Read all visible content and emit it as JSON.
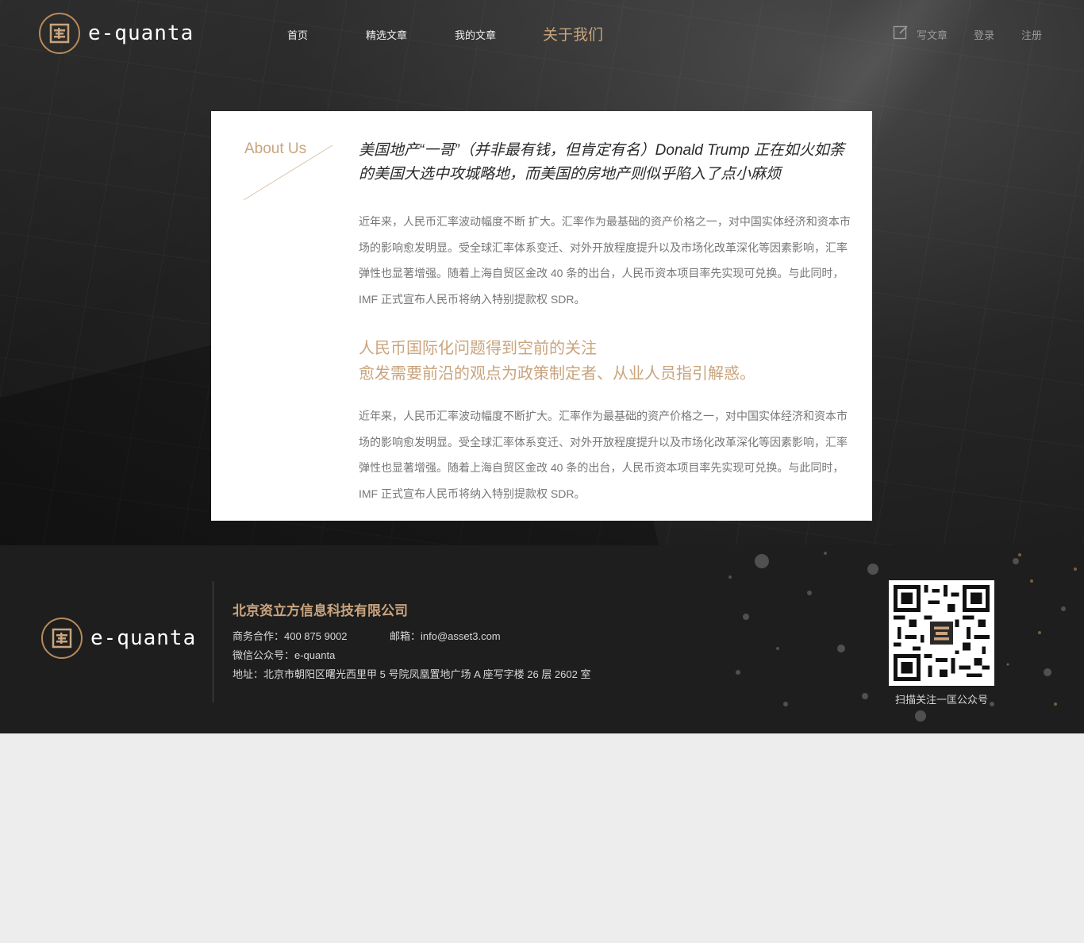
{
  "brand": {
    "name": "e-quanta"
  },
  "nav": {
    "items": [
      {
        "label": "首页"
      },
      {
        "label": "精选文章"
      },
      {
        "label": "我的文章"
      },
      {
        "label": "关于我们"
      }
    ],
    "write_label": "写文章",
    "login_label": "登录",
    "register_label": "注册"
  },
  "about": {
    "label": "About Us",
    "headline": "美国地产“一哥”（并非最有钱，但肯定有名）Donald Trump 正在如火如荼的美国大选中攻城略地，而美国的房地产则似乎陷入了点小麻烦",
    "paragraph1": "近年来，人民币汇率波动幅度不断 扩大。汇率作为最基础的资产价格之一，对中国实体经济和资本市场的影响愈发明显。受全球汇率体系变迁、对外开放程度提升以及市场化改革深化等因素影响，汇率弹性也显著增强。随着上海自贸区金改 40 条的出台，人民币资本项目率先实现可兑换。与此同时，IMF 正式宣布人民币将纳入特别提款权 SDR。",
    "subhead_line1": "人民币国际化问题得到空前的关注",
    "subhead_line2": "愈发需要前沿的观点为政策制定者、从业人员指引解惑。",
    "paragraph2": "近年来，人民币汇率波动幅度不断扩大。汇率作为最基础的资产价格之一，对中国实体经济和资本市场的影响愈发明显。受全球汇率体系变迁、对外开放程度提升以及市场化改革深化等因素影响，汇率弹性也显著增强。随着上海自贸区金改 40 条的出台，人民币资本项目率先实现可兑换。与此同时，IMF 正式宣布人民币将纳入特别提款权 SDR。"
  },
  "footer": {
    "company": "北京资立方信息科技有限公司",
    "business": "商务合作：400 875 9002",
    "email": "邮箱：info@asset3.com",
    "wechat": "微信公众号：e-quanta",
    "address": "地址：北京市朝阳区曙光西里甲 5 号院凤凰置地广场 A 座写字楼 26 层 2602 室",
    "qr_caption": "扫描关注一匡公众号"
  },
  "colors": {
    "accent": "#c9a47d",
    "footer_bg": "#1e1e1e",
    "page_bg": "#ededed"
  }
}
